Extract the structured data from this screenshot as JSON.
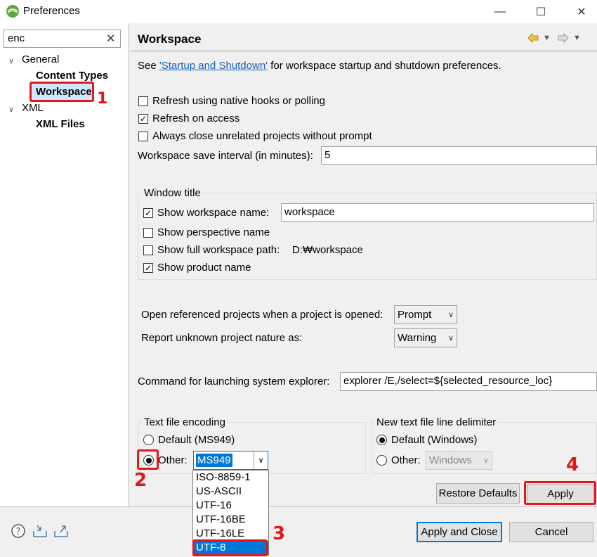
{
  "window": {
    "title": "Preferences",
    "minimize": "—",
    "maximize": "☐",
    "close": "✕"
  },
  "filter": {
    "value": "enc",
    "clear": "✕"
  },
  "tree": {
    "general": "General",
    "content_types": "Content Types",
    "workspace": "Workspace",
    "xml": "XML",
    "xml_files": "XML Files"
  },
  "page": {
    "title": "Workspace",
    "see_prefix": "See ",
    "see_link": "'Startup and Shutdown'",
    "see_suffix": " for workspace startup and shutdown preferences.",
    "refresh_native": {
      "label": "Refresh using native hooks or polling",
      "checked": false
    },
    "refresh_access": {
      "label": "Refresh on access",
      "checked": true
    },
    "always_close": {
      "label": "Always close unrelated projects without prompt",
      "checked": false
    },
    "save_interval_label": "Workspace save interval (in minutes):",
    "save_interval_value": "5",
    "window_title_group": "Window title",
    "show_ws_name": {
      "label": "Show workspace name:",
      "checked": true,
      "value": "workspace"
    },
    "show_perspective": {
      "label": "Show perspective name",
      "checked": false
    },
    "show_full_path": {
      "label": "Show full workspace path:",
      "checked": false,
      "value": "D:₩workspace"
    },
    "show_product": {
      "label": "Show product name",
      "checked": true
    },
    "open_ref_label": "Open referenced projects when a project is opened:",
    "open_ref_value": "Prompt",
    "report_nature_label": "Report unknown project nature as:",
    "report_nature_value": "Warning",
    "explorer_label": "Command for launching system explorer:",
    "explorer_value": "explorer /E,/select=${selected_resource_loc}",
    "encoding_group": "Text file encoding",
    "encoding_default": "Default (MS949)",
    "encoding_other": "Other:",
    "encoding_value": "MS949",
    "encoding_options": [
      "ISO-8859-1",
      "US-ASCII",
      "UTF-16",
      "UTF-16BE",
      "UTF-16LE",
      "UTF-8"
    ],
    "delimiter_group": "New text file line delimiter",
    "delimiter_default": "Default (Windows)",
    "delimiter_other": "Other:",
    "delimiter_value": "Windows",
    "restore_defaults": "Restore Defaults",
    "apply": "Apply"
  },
  "footer": {
    "apply_close": "Apply and Close",
    "cancel": "Cancel"
  },
  "annotations": {
    "n1": "1",
    "n2": "2",
    "n3": "3",
    "n4": "4"
  },
  "colors": {
    "accent": "#0078d7",
    "annotation": "#e8141c",
    "link": "#1a5fb4"
  }
}
